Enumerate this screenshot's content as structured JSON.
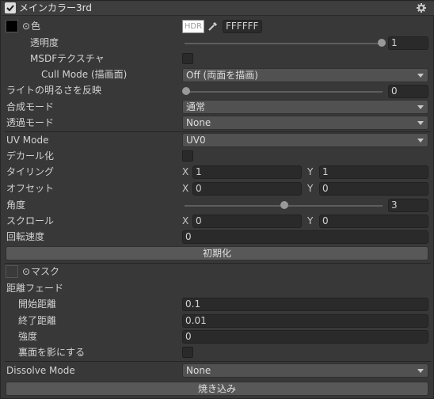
{
  "header": {
    "title": "メインカラー3rd",
    "enabled": true
  },
  "color": {
    "label": "色",
    "hdr_label": "HDR",
    "hex_value": "FFFFFF",
    "swatch_color": "#000000",
    "transparency_label": "透明度",
    "transparency_value": "1",
    "transparency_fraction": 1.0,
    "msdf_label": "MSDFテクスチャ",
    "cull_label": "Cull Mode (描画面)",
    "cull_value": "Off (両面を描画)"
  },
  "light": {
    "label": "ライトの明るさを反映",
    "value": "0",
    "fraction": 0.0
  },
  "blend": {
    "label": "合成モード",
    "value": "通常"
  },
  "transparent": {
    "label": "透過モード",
    "value": "None"
  },
  "uv": {
    "mode_label": "UV Mode",
    "mode_value": "UV0",
    "decal_label": "デカール化",
    "tiling_label": "タイリング",
    "tiling_x": "1",
    "tiling_y": "1",
    "offset_label": "オフセット",
    "offset_x": "0",
    "offset_y": "0",
    "angle_label": "角度",
    "angle_value": "3",
    "angle_fraction": 0.5,
    "scroll_label": "スクロール",
    "scroll_x": "0",
    "scroll_y": "0",
    "rotation_label": "回転速度",
    "rotation_value": "0",
    "reset_label": "初期化",
    "x_label": "X",
    "y_label": "Y"
  },
  "mask": {
    "label": "マスク"
  },
  "distance_fade": {
    "label": "距離フェード",
    "start_label": "開始距離",
    "start_value": "0.1",
    "end_label": "終了距離",
    "end_value": "0.01",
    "strength_label": "強度",
    "strength_value": "0",
    "backface_label": "裏面を影にする"
  },
  "dissolve": {
    "label": "Dissolve Mode",
    "value": "None"
  },
  "bake": {
    "label": "焼き込み"
  }
}
